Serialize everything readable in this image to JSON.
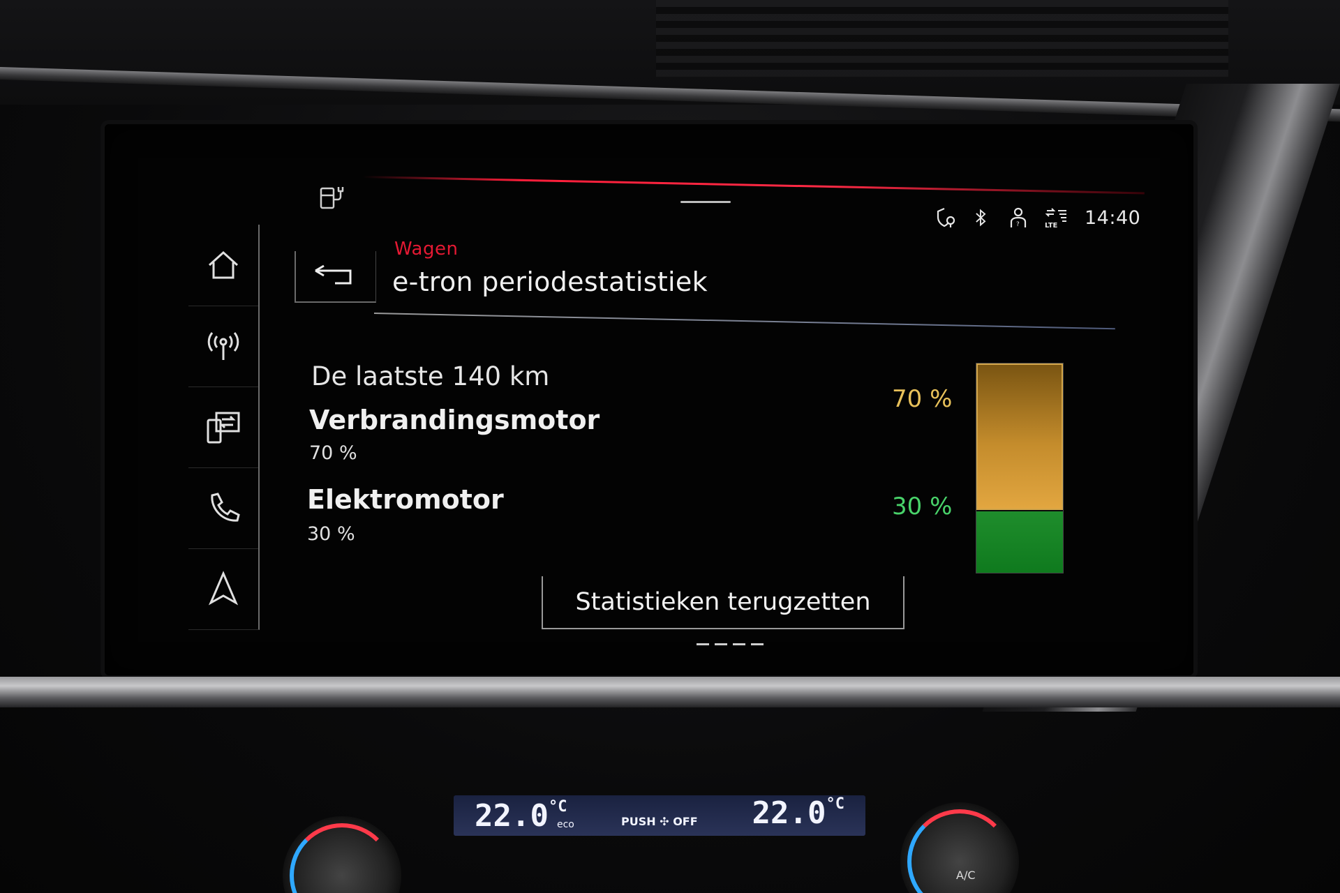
{
  "header": {
    "breadcrumb": "Wagen",
    "title": "e-tron periodestatistiek"
  },
  "status_bar": {
    "time": "14:40",
    "lte_label": "LTE",
    "icons": [
      "charge-station-icon",
      "location-shield-icon",
      "bluetooth-icon",
      "user-profile-icon",
      "lte-signal-icon"
    ]
  },
  "sidebar": {
    "items": [
      {
        "name": "home",
        "icon": "home-icon"
      },
      {
        "name": "radio",
        "icon": "radio-antenna-icon"
      },
      {
        "name": "phone-mirror",
        "icon": "smartphone-interface-icon"
      },
      {
        "name": "phone",
        "icon": "phone-icon"
      },
      {
        "name": "navigation",
        "icon": "navigation-arrow-icon"
      }
    ]
  },
  "stats": {
    "distance_label": "De laatste 140 km",
    "rows": [
      {
        "label": "Verbrandingsmotor",
        "value": "70 %"
      },
      {
        "label": "Elektromotor",
        "value": "30 %"
      }
    ],
    "bar": {
      "top_pct_label": "70 %",
      "bottom_pct_label": "30 %",
      "combustion_share": 0.7,
      "electric_share": 0.3,
      "combustion_color": "#c48c2c",
      "electric_color": "#1f8d2c"
    }
  },
  "actions": {
    "reset_label": "Statistieken terugzetten"
  },
  "climate": {
    "left_temp": "22.0",
    "right_temp": "22.0",
    "unit": "°C",
    "eco_label": "eco",
    "push_label": "PUSH",
    "off_label": "OFF",
    "ac_label": "A/C"
  }
}
